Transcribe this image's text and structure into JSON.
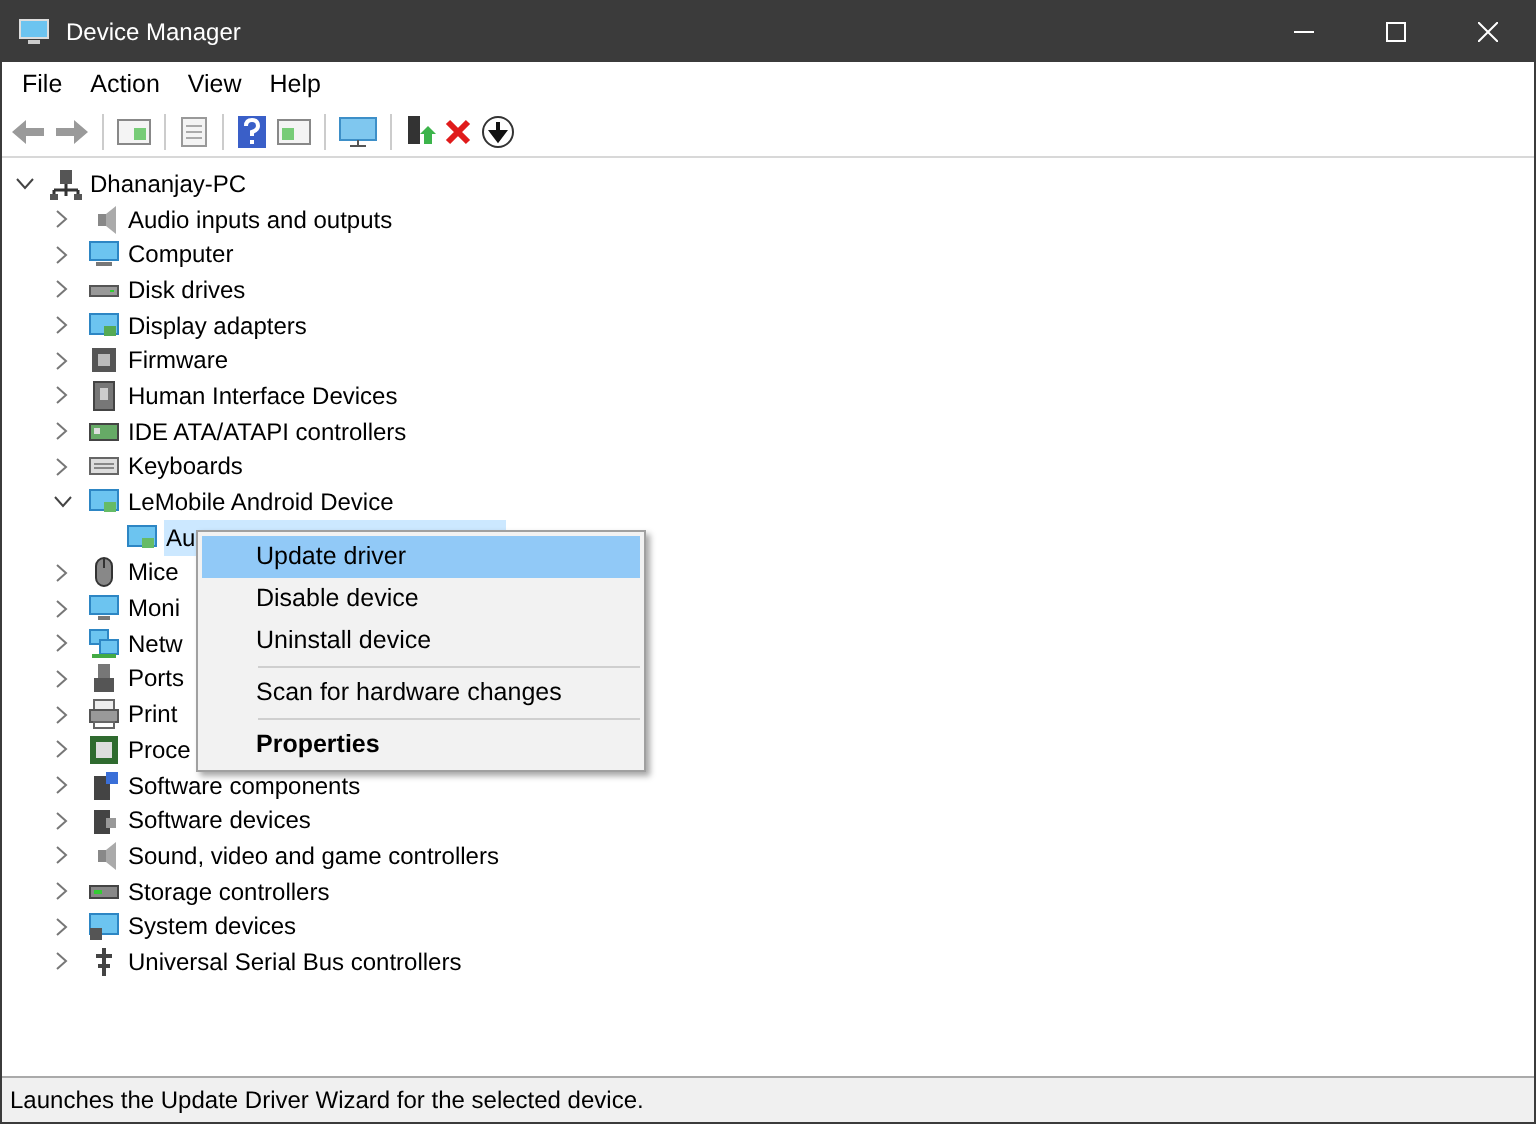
{
  "window": {
    "title": "Device Manager"
  },
  "menu_bar": [
    "File",
    "Action",
    "View",
    "Help"
  ],
  "tree": {
    "label": "Dhananjay-PC",
    "expanded": true,
    "selected": false,
    "children": [
      {
        "label": "Audio inputs and outputs",
        "expanded": false,
        "selected": false
      },
      {
        "label": "Computer",
        "expanded": false,
        "selected": false
      },
      {
        "label": "Disk drives",
        "expanded": false,
        "selected": false
      },
      {
        "label": "Display adapters",
        "expanded": false,
        "selected": false
      },
      {
        "label": "Firmware",
        "expanded": false,
        "selected": false
      },
      {
        "label": "Human Interface Devices",
        "expanded": false,
        "selected": false
      },
      {
        "label": "IDE ATA/ATAPI controllers",
        "expanded": false,
        "selected": false
      },
      {
        "label": "Keyboards",
        "expanded": false,
        "selected": false
      },
      {
        "label": "LeMobile Android Device",
        "expanded": true,
        "selected": false,
        "children": [
          {
            "label": "Au",
            "selected": true
          }
        ]
      },
      {
        "label": "Mice",
        "expanded": false,
        "selected": false
      },
      {
        "label": "Moni",
        "expanded": false,
        "selected": false
      },
      {
        "label": "Netw",
        "expanded": false,
        "selected": false
      },
      {
        "label": "Ports",
        "expanded": false,
        "selected": false
      },
      {
        "label": "Print",
        "expanded": false,
        "selected": false
      },
      {
        "label": "Proce",
        "expanded": false,
        "selected": false
      },
      {
        "label": "Software components",
        "expanded": false,
        "selected": false
      },
      {
        "label": "Software devices",
        "expanded": false,
        "selected": false
      },
      {
        "label": "Sound, video and game controllers",
        "expanded": false,
        "selected": false
      },
      {
        "label": "Storage controllers",
        "expanded": false,
        "selected": false
      },
      {
        "label": "System devices",
        "expanded": false,
        "selected": false
      },
      {
        "label": "Universal Serial Bus controllers",
        "expanded": false,
        "selected": false
      }
    ]
  },
  "context_menu": {
    "items": [
      {
        "kind": "item",
        "label": "Update driver",
        "selected": true,
        "default": false
      },
      {
        "kind": "item",
        "label": "Disable device",
        "selected": false,
        "default": false
      },
      {
        "kind": "item",
        "label": "Uninstall device",
        "selected": false,
        "default": false
      },
      {
        "kind": "separator"
      },
      {
        "kind": "item",
        "label": "Scan for hardware changes",
        "selected": false,
        "default": false
      },
      {
        "kind": "separator"
      },
      {
        "kind": "item",
        "label": "Properties",
        "selected": false,
        "default": true
      }
    ]
  },
  "status_bar": "Launches the Update Driver Wizard for the selected device."
}
